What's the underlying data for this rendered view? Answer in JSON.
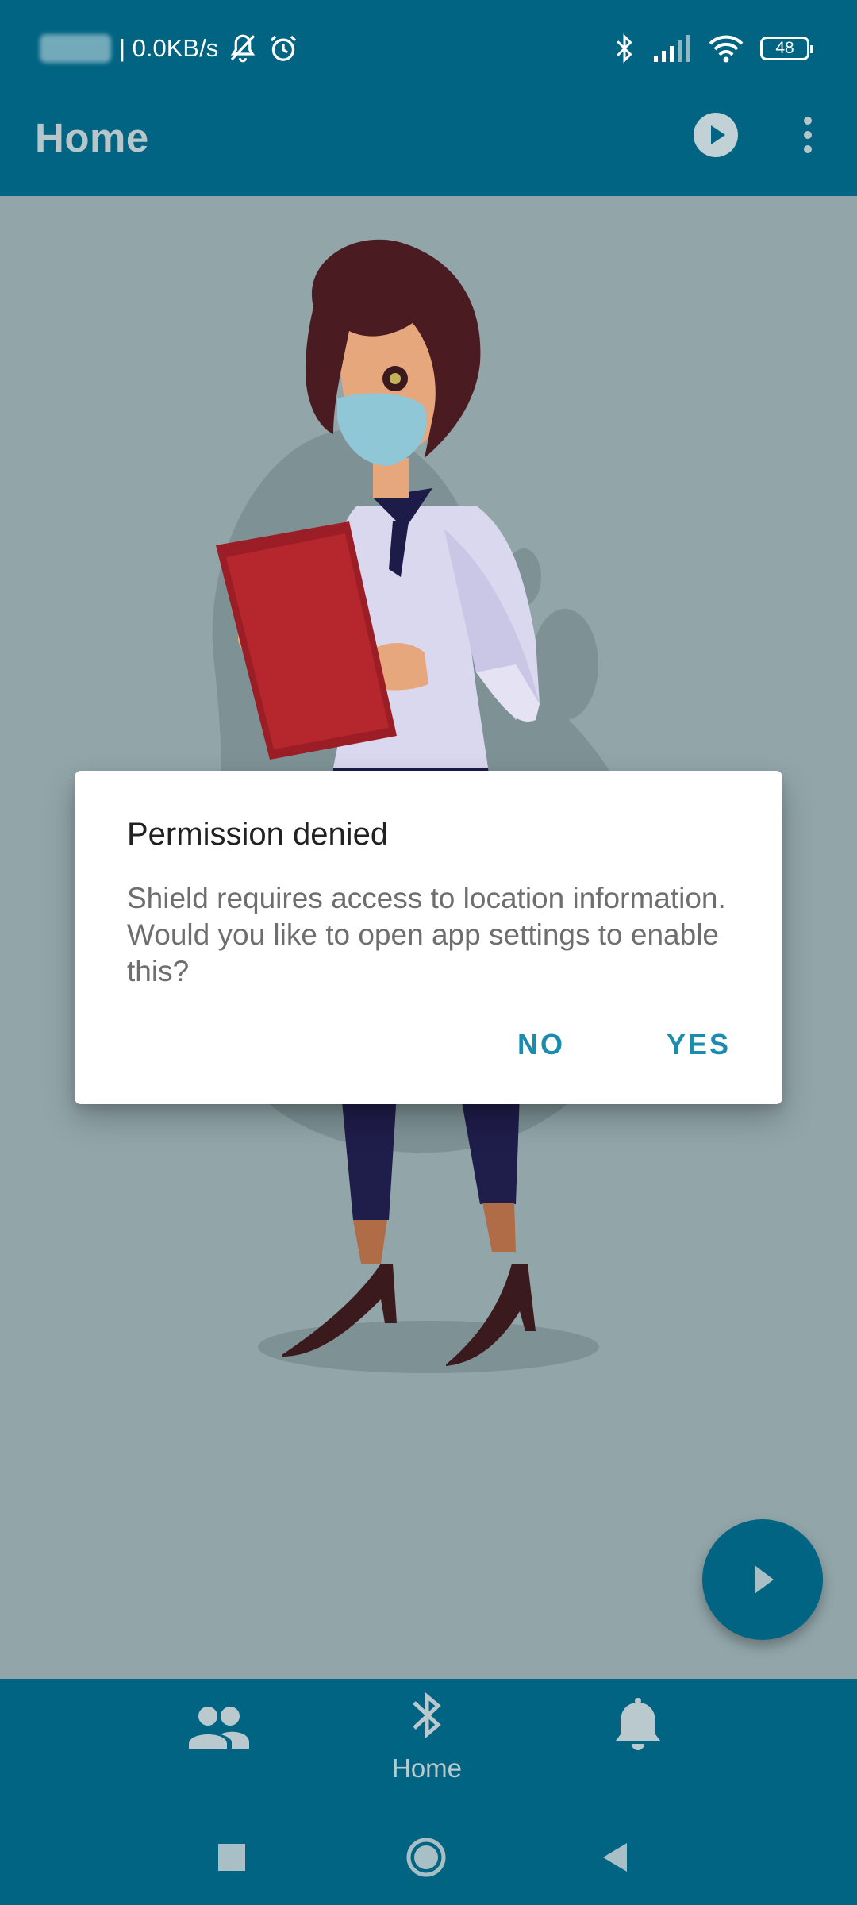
{
  "status_bar": {
    "network_speed": "| 0.0KB/s",
    "battery_level": "48"
  },
  "app_bar": {
    "title": "Home"
  },
  "dialog": {
    "title": "Permission denied",
    "message": "Shield requires access to location information. Would you like to open app settings to enable this?",
    "negative_label": "NO",
    "positive_label": "YES"
  },
  "bottom_nav": {
    "items": [
      {
        "icon": "people-icon",
        "label": ""
      },
      {
        "icon": "bluetooth-icon",
        "label": "Home"
      },
      {
        "icon": "bell-icon",
        "label": ""
      }
    ]
  },
  "colors": {
    "primary": "#006482",
    "accent": "#1d8bad",
    "scrim_background": "#92a6aa"
  }
}
